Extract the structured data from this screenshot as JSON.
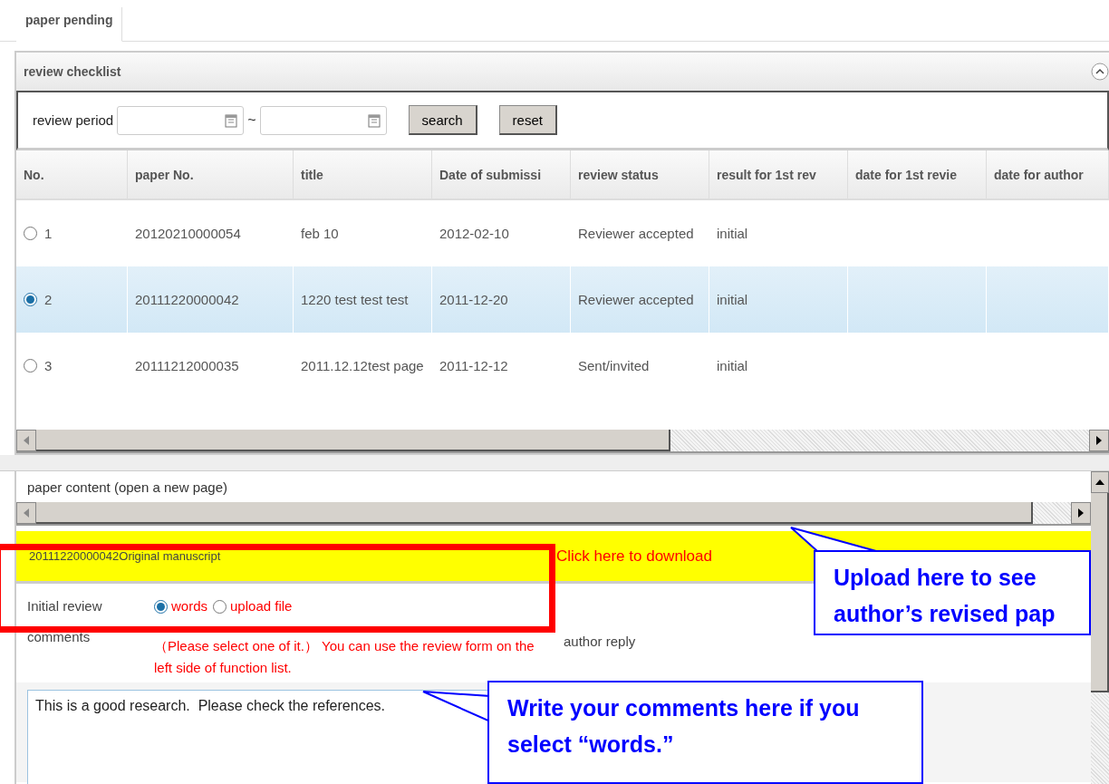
{
  "tabs": [
    {
      "label": "paper pending",
      "selected": true
    }
  ],
  "panel": {
    "title": "review checklist"
  },
  "search": {
    "label": "review period",
    "separator": "~",
    "buttons": [
      "search",
      "reset"
    ]
  },
  "table": {
    "columns": [
      "No.",
      "paper No.",
      "title",
      "Date of submissi",
      "review status",
      "result for 1st rev",
      "date for 1st revie",
      "date for author"
    ],
    "rows": [
      {
        "selected": false,
        "cells": [
          "1",
          "20120210000054",
          "feb 10",
          "2012-02-10",
          "Reviewer accepted",
          "initial"
        ]
      },
      {
        "selected": true,
        "cells": [
          "2",
          "20111220000042",
          "1220 test test test",
          "2011-12-20",
          "Reviewer accepted",
          "initial"
        ]
      },
      {
        "selected": false,
        "cells": [
          "3",
          "20111212000035",
          "2011.12.12test page",
          "2011-12-12",
          "Sent/invited",
          "initial"
        ]
      }
    ]
  },
  "content": {
    "link": "paper content (open a new page)",
    "file_name": "20111220000042Original manuscript",
    "download": "Click here to download",
    "review_label": "Initial review comments",
    "options": [
      {
        "label": "words",
        "selected": true
      },
      {
        "label": "upload file",
        "selected": false
      }
    ],
    "hint": "（Please select one of it.） You can use the review form on the left side of function list.",
    "reply_label": "author reply",
    "comment": "This is a good research.  Please check the references."
  },
  "callouts": [
    {
      "text": "Upload here to see author’s revised pap"
    },
    {
      "text": "Write your comments here if you select “words.”"
    }
  ]
}
